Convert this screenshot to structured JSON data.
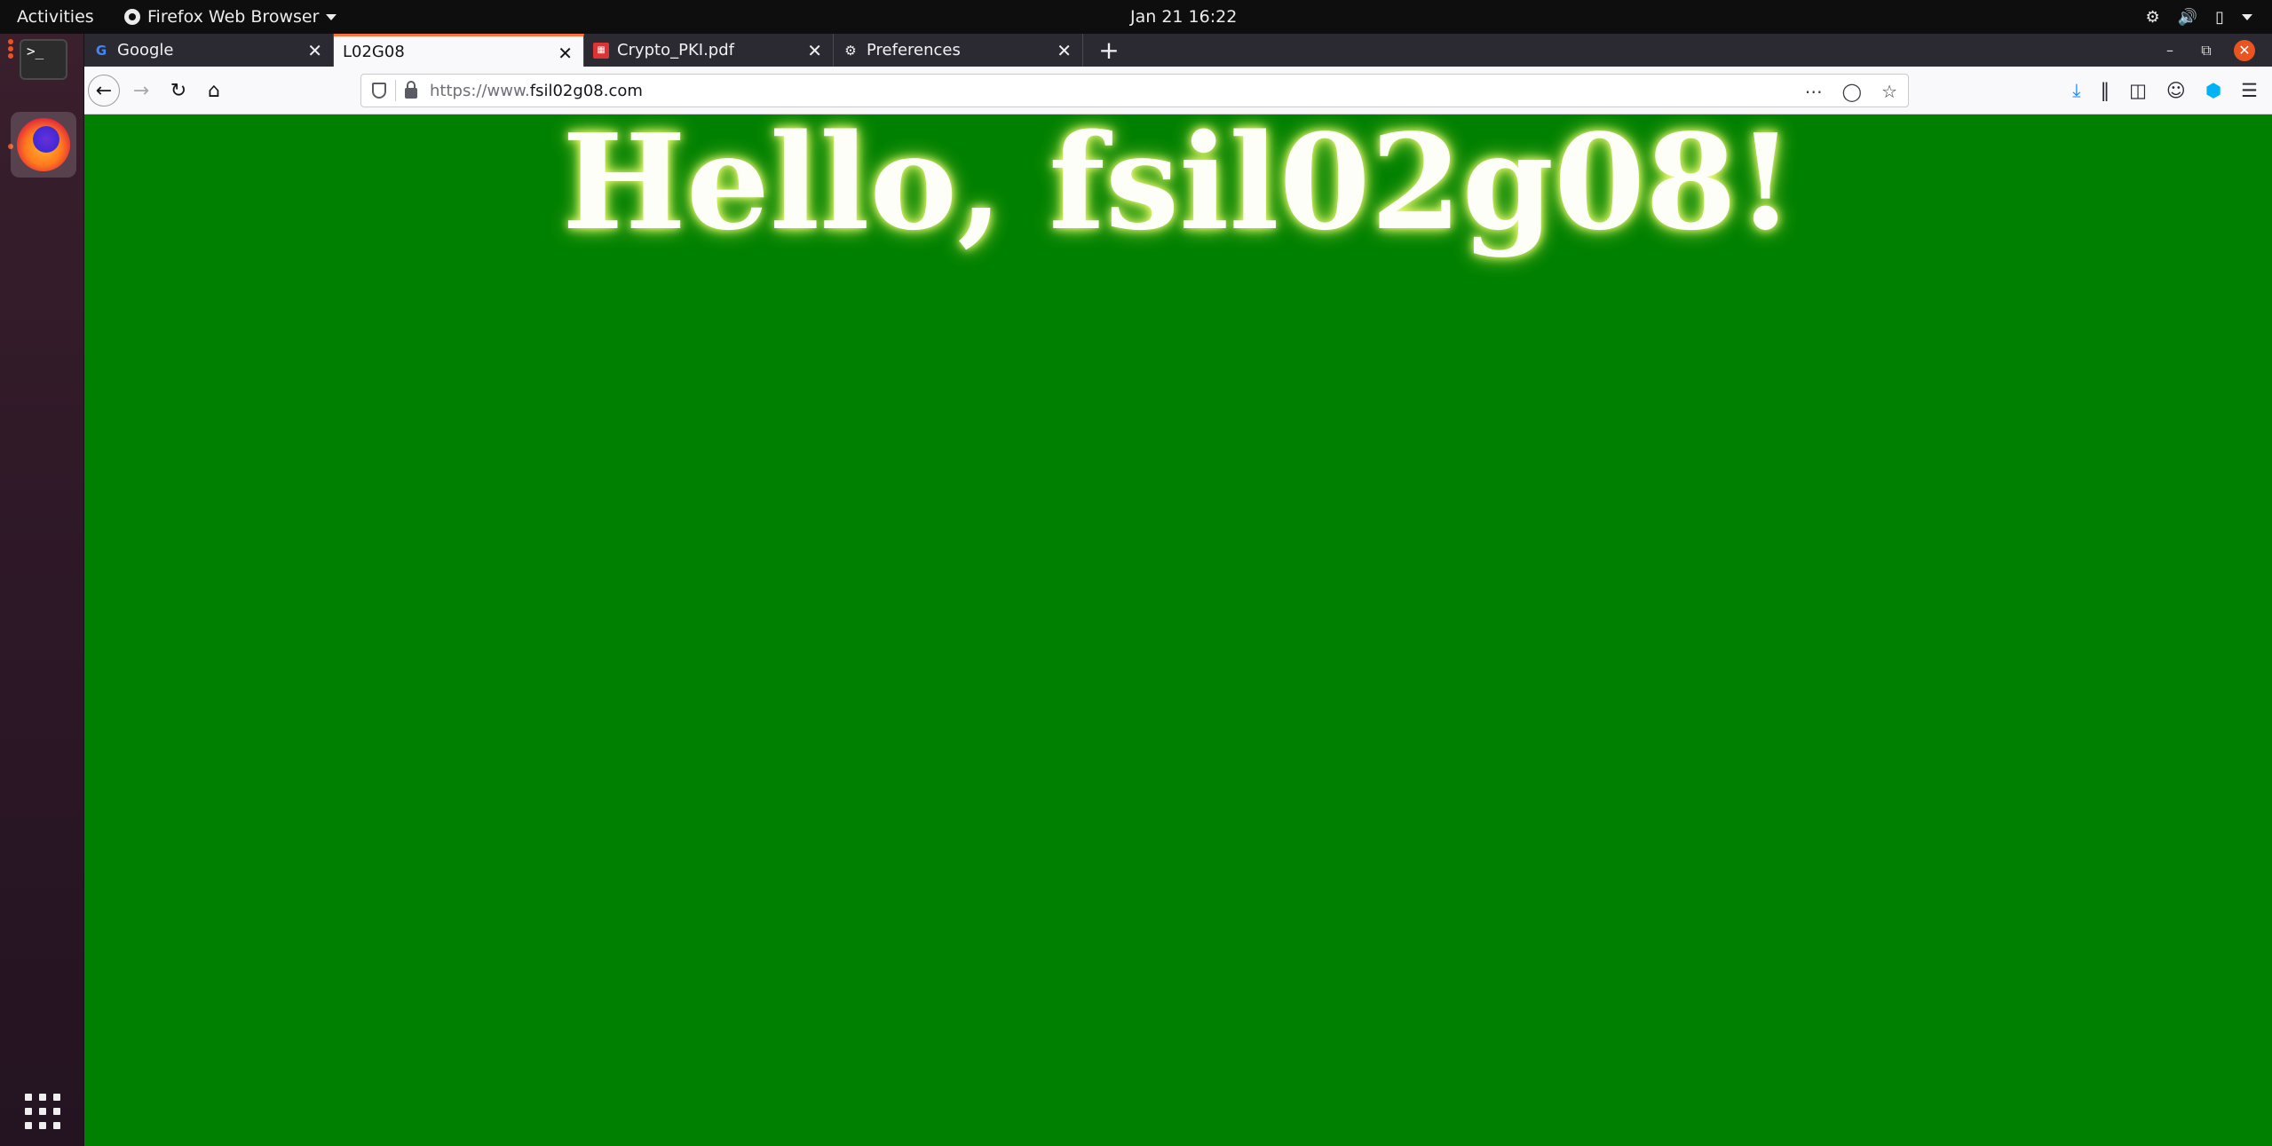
{
  "topbar": {
    "activities": "Activities",
    "app_name": "Firefox Web Browser",
    "clock": "Jan 21  16:22",
    "tray_icons": [
      "network-icon",
      "volume-icon",
      "battery-icon",
      "system-menu-caret-icon"
    ]
  },
  "dock": {
    "items": [
      {
        "name": "Terminal",
        "icon": "terminal-icon",
        "glyph": ">_"
      },
      {
        "name": "Firefox",
        "icon": "firefox-icon"
      }
    ],
    "show_apps_icon": "app-grid-icon"
  },
  "browser": {
    "tabs": [
      {
        "label": "Google",
        "favicon": "google-icon",
        "active": false
      },
      {
        "label": "L02G08",
        "favicon": "",
        "active": true
      },
      {
        "label": "Crypto_PKI.pdf",
        "favicon": "pdf-icon",
        "active": false
      },
      {
        "label": "Preferences",
        "favicon": "gear-icon",
        "active": false
      }
    ],
    "url_prefix": "https://www.",
    "url_domain": "fsil02g08.com",
    "colors": {
      "accent_tab": "#ff7139",
      "page_background": "#008000",
      "close_button": "#e95420"
    }
  },
  "page": {
    "greeting": "Hello, fsil02g08!"
  }
}
